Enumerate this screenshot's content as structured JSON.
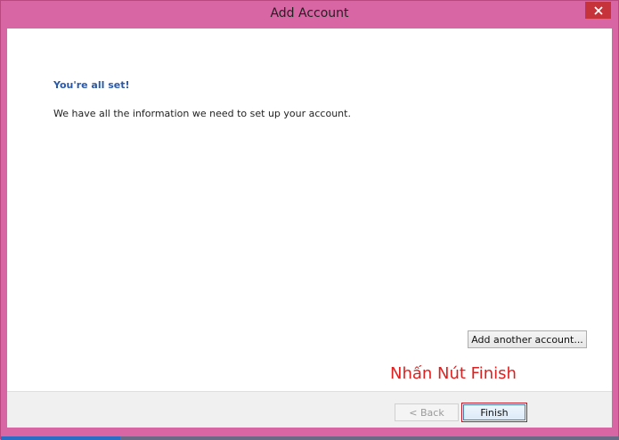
{
  "window": {
    "title": "Add Account"
  },
  "content": {
    "heading": "You're all set!",
    "message": "We have all the information we need to set up your account."
  },
  "buttons": {
    "add_another_label": "Add another account...",
    "back_label": "< Back",
    "finish_label": "Finish"
  },
  "annotation": {
    "text": "Nhấn Nút Finish",
    "color": "#e02020"
  },
  "colors": {
    "window_frame": "#d966a4",
    "close_button": "#c7333a",
    "heading": "#2a5aa8"
  },
  "icons": {
    "close": "close-icon"
  }
}
